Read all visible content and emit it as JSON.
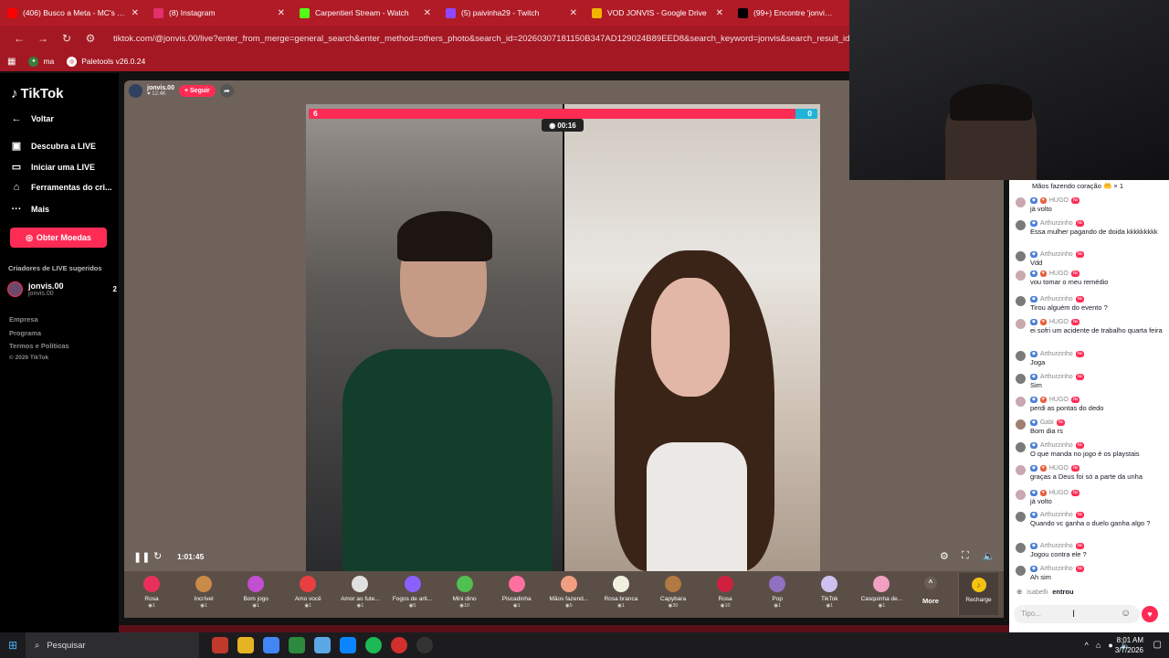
{
  "browser": {
    "tabs": [
      {
        "title": "(406) Busco a Meta - MC's Tuto",
        "icon": "youtube-icon",
        "color": "#ff0000"
      },
      {
        "title": "(8) Instagram",
        "icon": "instagram-icon",
        "color": "#e1306c"
      },
      {
        "title": "Carpentieri Stream - Watch",
        "icon": "kick-icon",
        "color": "#53fc18"
      },
      {
        "title": "(5) paivinha29 - Twitch",
        "icon": "twitch-icon",
        "color": "#9146ff"
      },
      {
        "title": "VOD JONVIS - Google Drive",
        "icon": "drive-icon",
        "color": "#f4b400"
      },
      {
        "title": "(99+) Encontre 'jonvis' no",
        "icon": "tiktok-icon",
        "color": "#000000"
      }
    ],
    "url": "tiktok.com/@jonvis.00/live?enter_from_merge=general_search&enter_method=others_photo&search_id=20260307181150B347AD129024B89EED8&search_keyword=jonvis&search_result_id=2422438",
    "bookmarks": [
      {
        "label": "ma"
      },
      {
        "label": "Paletools v26.0.24"
      }
    ]
  },
  "sidebar": {
    "logo": "TikTok",
    "back": "Voltar",
    "items": [
      {
        "label": "Descubra a LIVE",
        "icon": "live-icon"
      },
      {
        "label": "Iniciar uma LIVE",
        "icon": "camera-icon"
      },
      {
        "label": "Ferramentas do cri...",
        "icon": "home-icon"
      },
      {
        "label": "Mais",
        "icon": "more-icon"
      }
    ],
    "coins_button": "Obter Moedas",
    "suggested_title": "Criadores de LIVE sugeridos",
    "creator": {
      "name": "jonvis.00",
      "handle": "jonvis.00",
      "count": "2"
    },
    "footer": [
      "Empresa",
      "Programa",
      "Termos e Políticas",
      "© 2026 TikTok"
    ]
  },
  "live": {
    "host_name": "jonvis.00",
    "host_viewers": "12.4K",
    "follow_label": "+ Seguir",
    "pk_left": "6",
    "pk_right": "0",
    "timer": "00:16",
    "time_elapsed": "1:01:45"
  },
  "gifts": [
    {
      "name": "Rosa",
      "price": "1",
      "color": "#e8305a"
    },
    {
      "name": "Incrível",
      "price": "1",
      "color": "#c98a4a"
    },
    {
      "name": "Bom jogo",
      "price": "1",
      "color": "#c050d0"
    },
    {
      "name": "Amo você",
      "price": "1",
      "color": "#e84040"
    },
    {
      "name": "Amor ao fute...",
      "price": "1",
      "color": "#e0e0e0"
    },
    {
      "name": "Fogos de arti...",
      "price": "5",
      "color": "#8a60ff"
    },
    {
      "name": "Mini dino",
      "price": "10",
      "color": "#50c050"
    },
    {
      "name": "Piscadinha",
      "price": "1",
      "color": "#ff70a0"
    },
    {
      "name": "Mãos fazend...",
      "price": "5",
      "color": "#f0a080"
    },
    {
      "name": "Rosa branca",
      "price": "1",
      "color": "#f0f0e0"
    },
    {
      "name": "Capybara",
      "price": "30",
      "color": "#b07a40"
    },
    {
      "name": "Rosa",
      "price": "10",
      "color": "#d02040"
    },
    {
      "name": "Pop",
      "price": "1",
      "color": "#9070c0"
    },
    {
      "name": "TikTok",
      "price": "1",
      "color": "#d0c0f0"
    },
    {
      "name": "Casquinha de...",
      "price": "1",
      "color": "#f0a0c0"
    }
  ],
  "more_label": "More",
  "recharge_label": "Recharge",
  "chat": {
    "top_line": "Mãos fazendo coração",
    "top_count": "× 1",
    "messages": [
      {
        "name": "HUGO",
        "text": "já volto",
        "color": "#c9a8b0"
      },
      {
        "name": "Arthurzinho",
        "text": "Essa mulher pagando de doida kkkkkkkkk",
        "color": "#7a7a7a"
      },
      {
        "name": "Arthurzinho",
        "text": "Vdd",
        "color": "#7a7a7a"
      },
      {
        "name": "HUGO",
        "text": "vou tomar o meu remédio",
        "color": "#c9a8b0"
      },
      {
        "name": "Arthurzinho",
        "text": "Tirou alguém do evento ?",
        "color": "#7a7a7a"
      },
      {
        "name": "HUGO",
        "text": "ei sofri um acidente de trabalho quarta feira",
        "color": "#c9a8b0"
      },
      {
        "name": "Arthurzinho",
        "text": "Joga",
        "color": "#7a7a7a"
      },
      {
        "name": "Arthurzinho",
        "text": "Sim",
        "color": "#7a7a7a"
      },
      {
        "name": "HUGO",
        "text": "perdi as pontas do dedo",
        "color": "#c9a8b0"
      },
      {
        "name": "Gabi",
        "text": "Bom dia rs",
        "color": "#a08070"
      },
      {
        "name": "Arthurzinho",
        "text": "O que manda no jogo é os playstais",
        "color": "#7a7a7a"
      },
      {
        "name": "HUGO",
        "text": "graças a Deus foi só a parte da unha",
        "color": "#c9a8b0"
      },
      {
        "name": "HUGO",
        "text": "já volto",
        "color": "#c9a8b0"
      },
      {
        "name": "Arthurzinho",
        "text": "Quando vc ganha o duelo ganha algo ?",
        "color": "#7a7a7a"
      },
      {
        "name": "Arthurzinho",
        "text": "Jogou contra ele ?",
        "color": "#7a7a7a"
      },
      {
        "name": "Arthurzinho",
        "text": "Ah sim",
        "color": "#7a7a7a"
      }
    ],
    "join_user": "isabelli",
    "join_text": "entrou",
    "input_placeholder": "Tipo..."
  },
  "taskbar": {
    "search": "Pesquisar",
    "time": "8:01 AM",
    "date": "3/7/2026"
  }
}
